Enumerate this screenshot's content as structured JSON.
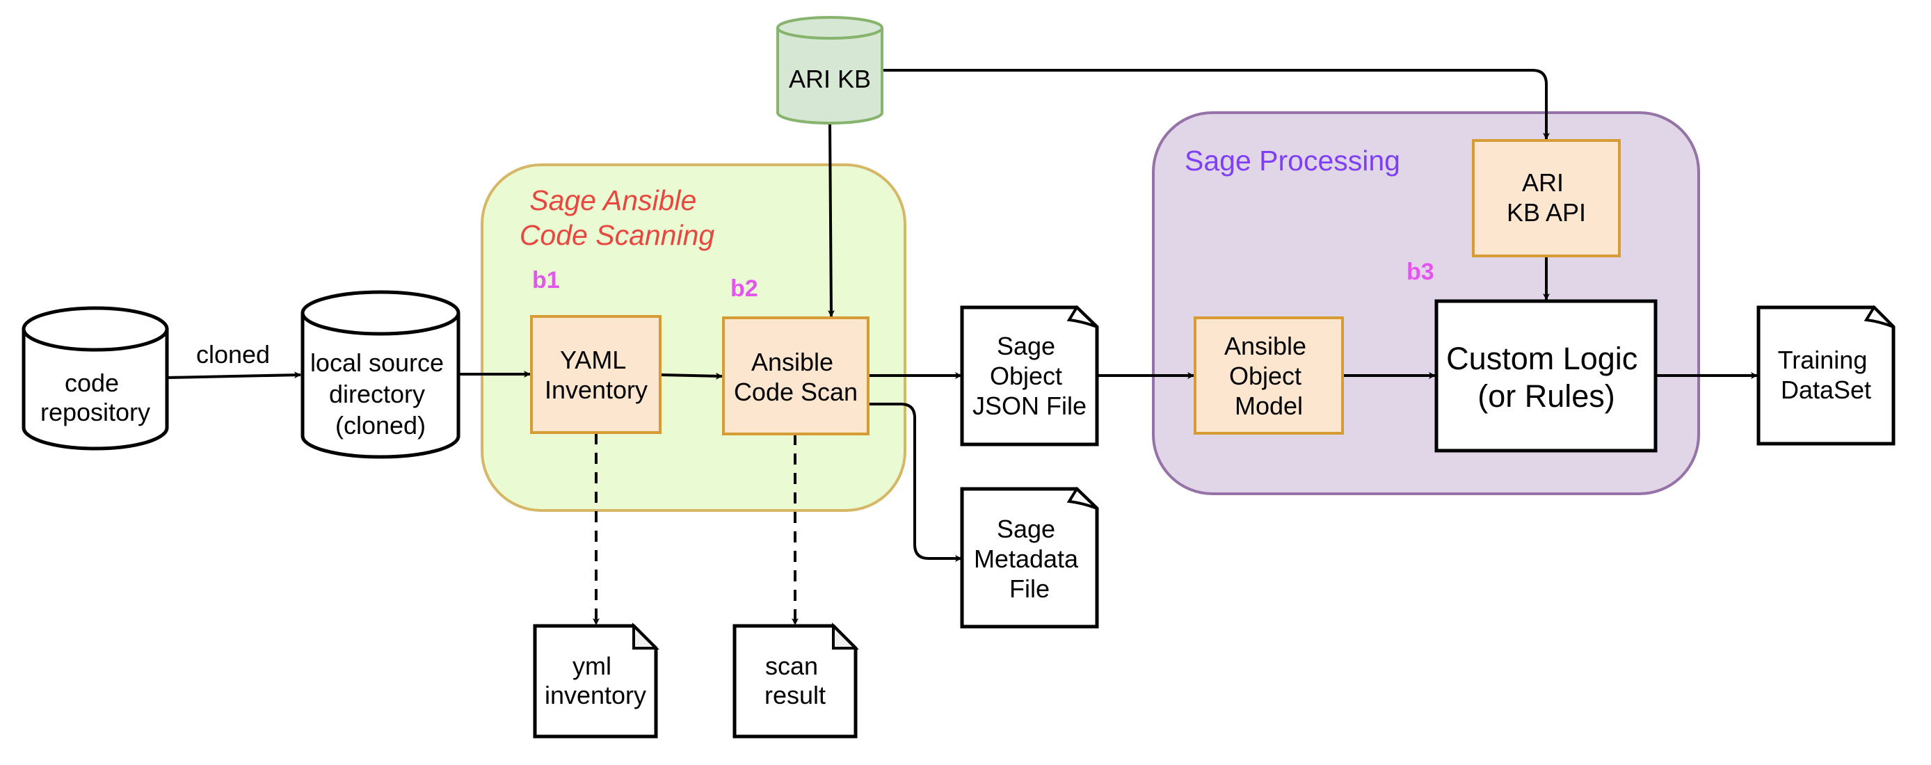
{
  "diagram": {
    "groups": {
      "scanning": {
        "title_line1": "Sage Ansible",
        "title_line2": "Code Scanning",
        "color": "#e8473f",
        "fill": "#eafad2",
        "stroke": "#d5b765"
      },
      "processing": {
        "title": "Sage Processing",
        "color": "#7f3ff6",
        "fill": "#e0d6e8",
        "stroke": "#9673a6"
      }
    },
    "tags": {
      "b1": "b1",
      "b2": "b2",
      "b3": "b3",
      "color": "#e455f0"
    },
    "nodes": {
      "code_repository": {
        "type": "database",
        "lines": [
          "code",
          "repository"
        ]
      },
      "local_source": {
        "type": "database",
        "lines": [
          "local source",
          "directory",
          "(cloned)"
        ]
      },
      "ari_kb": {
        "type": "database",
        "lines": [
          "ARI KB"
        ],
        "fill": "#d6e7d4",
        "stroke": "#86b46d"
      },
      "yaml_inventory": {
        "type": "process",
        "lines": [
          "YAML",
          "Inventory"
        ],
        "fill": "#fce6cf",
        "stroke": "#d79b34"
      },
      "ansible_code_scan": {
        "type": "process",
        "lines": [
          "Ansible",
          "Code Scan"
        ],
        "fill": "#fce6cf",
        "stroke": "#d79b34"
      },
      "sage_object_json": {
        "type": "document",
        "lines": [
          "Sage",
          "Object",
          "JSON File"
        ]
      },
      "sage_metadata": {
        "type": "document",
        "lines": [
          "Sage",
          "Metadata",
          "File"
        ]
      },
      "yml_inventory": {
        "type": "document",
        "lines": [
          "yml",
          "inventory"
        ]
      },
      "scan_result": {
        "type": "document",
        "lines": [
          "scan",
          "result"
        ]
      },
      "ari_kb_api": {
        "type": "process",
        "lines": [
          "ARI",
          "KB API"
        ],
        "fill": "#fce6cf",
        "stroke": "#d79b34"
      },
      "ansible_object_model": {
        "type": "process",
        "lines": [
          "Ansible",
          "Object",
          "Model"
        ],
        "fill": "#fce6cf",
        "stroke": "#d79b34"
      },
      "custom_logic": {
        "type": "process",
        "lines": [
          "Custom Logic",
          "(or Rules)"
        ]
      },
      "training_dataset": {
        "type": "document",
        "lines": [
          "Training",
          "DataSet"
        ]
      }
    },
    "edges": [
      {
        "from": "code_repository",
        "to": "local_source",
        "label": "cloned",
        "style": "solid"
      },
      {
        "from": "local_source",
        "to": "yaml_inventory",
        "style": "solid"
      },
      {
        "from": "yaml_inventory",
        "to": "ansible_code_scan",
        "style": "solid"
      },
      {
        "from": "ari_kb",
        "to": "ansible_code_scan",
        "style": "solid"
      },
      {
        "from": "ari_kb",
        "to": "ari_kb_api",
        "style": "solid"
      },
      {
        "from": "ansible_code_scan",
        "to": "sage_object_json",
        "style": "solid"
      },
      {
        "from": "ansible_code_scan",
        "to": "sage_metadata",
        "style": "solid"
      },
      {
        "from": "yaml_inventory",
        "to": "yml_inventory",
        "style": "dashed"
      },
      {
        "from": "ansible_code_scan",
        "to": "scan_result",
        "style": "dashed"
      },
      {
        "from": "sage_object_json",
        "to": "ansible_object_model",
        "style": "solid"
      },
      {
        "from": "ansible_object_model",
        "to": "custom_logic",
        "style": "solid"
      },
      {
        "from": "ari_kb_api",
        "to": "custom_logic",
        "style": "solid"
      },
      {
        "from": "custom_logic",
        "to": "training_dataset",
        "style": "solid"
      }
    ]
  }
}
